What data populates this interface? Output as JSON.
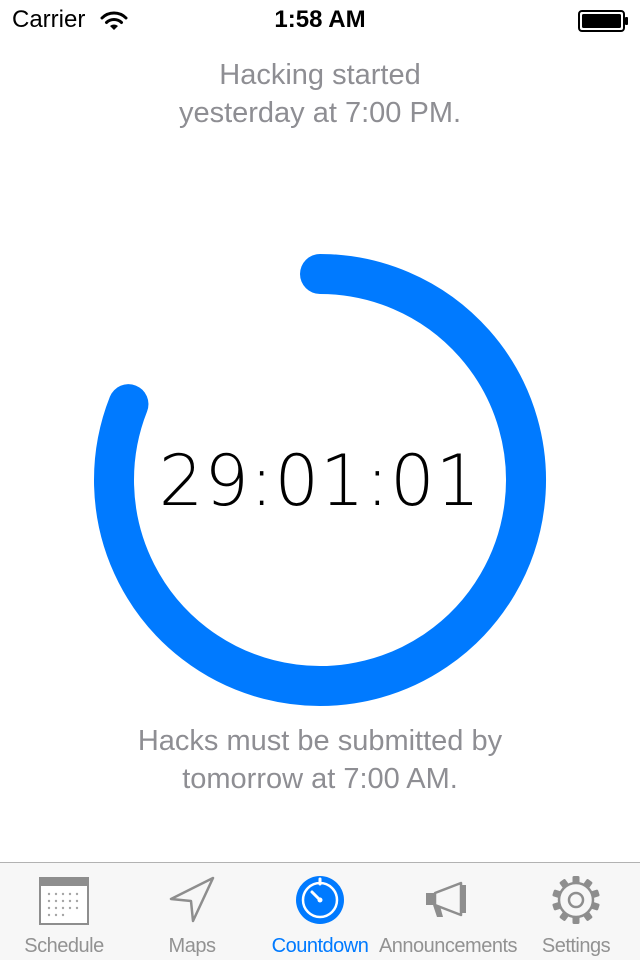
{
  "status_bar": {
    "carrier": "Carrier",
    "time": "1:58 AM",
    "wifi_icon": "wifi-icon",
    "battery_icon": "battery-full-icon"
  },
  "countdown": {
    "started_text_line1": "Hacking started",
    "started_text_line2": "yesterday at 7:00 PM.",
    "time_remaining": "29:01:01",
    "progress_fraction": 0.81,
    "deadline_text_line1": "Hacks must be submitted by",
    "deadline_text_line2": "tomorrow at 7:00 AM."
  },
  "tab_bar": {
    "active_tab": "Countdown",
    "tabs": [
      {
        "label": "Schedule",
        "icon": "calendar-icon"
      },
      {
        "label": "Maps",
        "icon": "location-arrow-icon"
      },
      {
        "label": "Countdown",
        "icon": "stopwatch-icon"
      },
      {
        "label": "Announcements",
        "icon": "megaphone-icon"
      },
      {
        "label": "Settings",
        "icon": "gear-icon"
      }
    ]
  },
  "colors": {
    "accent": "#007aff",
    "secondary_text": "#8e8e93",
    "tab_inactive": "#929292",
    "tab_bar_bg": "#f7f7f7"
  }
}
